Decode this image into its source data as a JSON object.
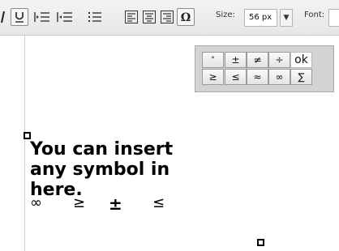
{
  "toolbar": {
    "size_label": "Size:",
    "size_value": "56 px",
    "font_label": "Font:"
  },
  "palette": {
    "symbols": [
      "°",
      "±",
      "≠",
      "÷",
      "ok",
      "≥",
      "≤",
      "≈",
      "∞",
      "∑"
    ]
  },
  "editor": {
    "text": "You can insert\nany symbol in\nhere.",
    "symbols": [
      "∞",
      "≥",
      "±",
      "≤"
    ]
  },
  "icons": [
    "underline-icon",
    "indent-icon",
    "outdent-icon",
    "list-icon",
    "align-left-icon",
    "align-center-icon",
    "align-right-icon",
    "omega-icon",
    "dropdown-arrow-icon"
  ]
}
